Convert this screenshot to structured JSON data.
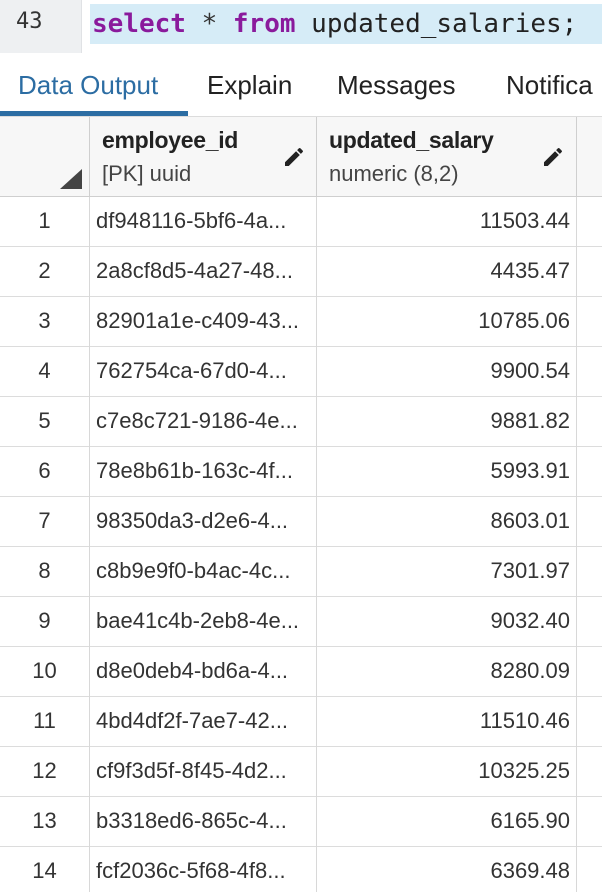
{
  "editor": {
    "line_number": "43",
    "tokens": {
      "kw1": "select",
      "op": " * ",
      "kw2": "from",
      "rest": " updated_salaries;"
    }
  },
  "tabs": [
    "Data Output",
    "Explain",
    "Messages",
    "Notifica"
  ],
  "columns": [
    {
      "name": "employee_id",
      "type": "[PK] uuid"
    },
    {
      "name": "updated_salary",
      "type": "numeric (8,2)"
    }
  ],
  "rows": [
    {
      "n": "1",
      "id": "df948116-5bf6-4a...",
      "salary": "11503.44"
    },
    {
      "n": "2",
      "id": "2a8cf8d5-4a27-48...",
      "salary": "4435.47"
    },
    {
      "n": "3",
      "id": "82901a1e-c409-43...",
      "salary": "10785.06"
    },
    {
      "n": "4",
      "id": "762754ca-67d0-4...",
      "salary": "9900.54"
    },
    {
      "n": "5",
      "id": "c7e8c721-9186-4e...",
      "salary": "9881.82"
    },
    {
      "n": "6",
      "id": "78e8b61b-163c-4f...",
      "salary": "5993.91"
    },
    {
      "n": "7",
      "id": "98350da3-d2e6-4...",
      "salary": "8603.01"
    },
    {
      "n": "8",
      "id": "c8b9e9f0-b4ac-4c...",
      "salary": "7301.97"
    },
    {
      "n": "9",
      "id": "bae41c4b-2eb8-4e...",
      "salary": "9032.40"
    },
    {
      "n": "10",
      "id": "d8e0deb4-bd6a-4...",
      "salary": "8280.09"
    },
    {
      "n": "11",
      "id": "4bd4df2f-7ae7-42...",
      "salary": "11510.46"
    },
    {
      "n": "12",
      "id": "cf9f3d5f-8f45-4d2...",
      "salary": "10325.25"
    },
    {
      "n": "13",
      "id": "b3318ed6-865c-4...",
      "salary": "6165.90"
    },
    {
      "n": "14",
      "id": "fcf2036c-5f68-4f8...",
      "salary": "6369.48"
    }
  ],
  "icons": {
    "edit": "pencil-icon",
    "sort_corner": "select-all-corner-icon"
  },
  "colors": {
    "accent": "#2c6da3",
    "keyword": "#8a1a9c",
    "highlight": "#d6ecf7"
  }
}
